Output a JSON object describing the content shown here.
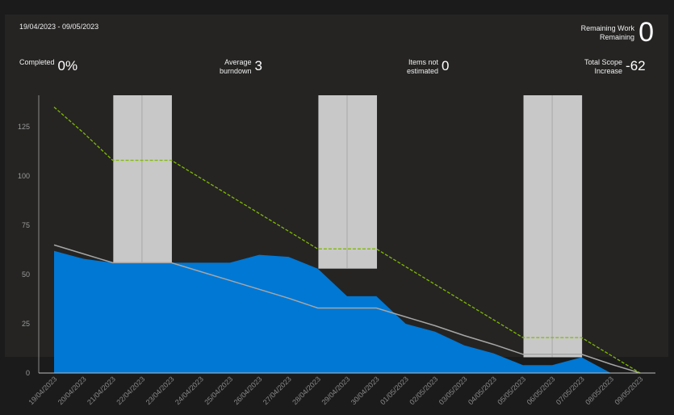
{
  "header": {
    "date_range": "19/04/2023 - 09/05/2023",
    "remaining_work_label": "Remaining Work",
    "remaining_sub_label": "Remaining",
    "remaining_value": "0"
  },
  "metrics": {
    "completed_label": "Completed",
    "completed_value": "0%",
    "avg_burndown_label_1": "Average",
    "avg_burndown_label_2": "burndown",
    "avg_burndown_value": "3",
    "not_estimated_label_1": "Items not",
    "not_estimated_label_2": "estimated",
    "not_estimated_value": "0",
    "scope_label_1": "Total Scope",
    "scope_label_2": "Increase",
    "scope_value": "-62"
  },
  "colors": {
    "remaining_fill": "#0078d4",
    "ideal_line": "#a6a6a6",
    "scope_line": "#7fba00",
    "weekend_band": "#c8c8c8",
    "panel_bg": "#252423",
    "axis": "#8a8a8a"
  },
  "chart_data": {
    "type": "area",
    "x": [
      "19/04/2023",
      "20/04/2023",
      "21/04/2023",
      "22/04/2023",
      "23/04/2023",
      "24/04/2023",
      "25/04/2023",
      "26/04/2023",
      "27/04/2023",
      "28/04/2023",
      "29/04/2023",
      "30/04/2023",
      "01/05/2023",
      "02/05/2023",
      "03/05/2023",
      "04/05/2023",
      "05/05/2023",
      "06/05/2023",
      "07/05/2023",
      "08/05/2023",
      "09/05/2023"
    ],
    "y_ticks": [
      0,
      25,
      50,
      75,
      100,
      125
    ],
    "ylim": [
      0,
      141
    ],
    "grid": false,
    "weekend_bands": [
      [
        "21/04/2023",
        "23/04/2023"
      ],
      [
        "28/04/2023",
        "30/04/2023"
      ],
      [
        "05/05/2023",
        "07/05/2023"
      ]
    ],
    "series": [
      {
        "role": "remaining",
        "values": [
          62,
          58,
          56,
          56,
          56,
          56,
          56,
          60,
          59,
          53,
          39,
          39,
          25,
          21,
          14,
          10,
          4,
          4,
          8,
          0,
          0
        ]
      },
      {
        "role": "ideal",
        "values": [
          65,
          60.5,
          56,
          56,
          56,
          51.5,
          47,
          42.5,
          38,
          33,
          33,
          33,
          28.5,
          24,
          19,
          14.5,
          9.5,
          9.5,
          9.5,
          4.5,
          0
        ]
      },
      {
        "role": "scope",
        "values": [
          135,
          122,
          108,
          108,
          108,
          99,
          90,
          81,
          72,
          63,
          63,
          63,
          54,
          45,
          36,
          27,
          18,
          18,
          18,
          9,
          0
        ]
      }
    ]
  }
}
